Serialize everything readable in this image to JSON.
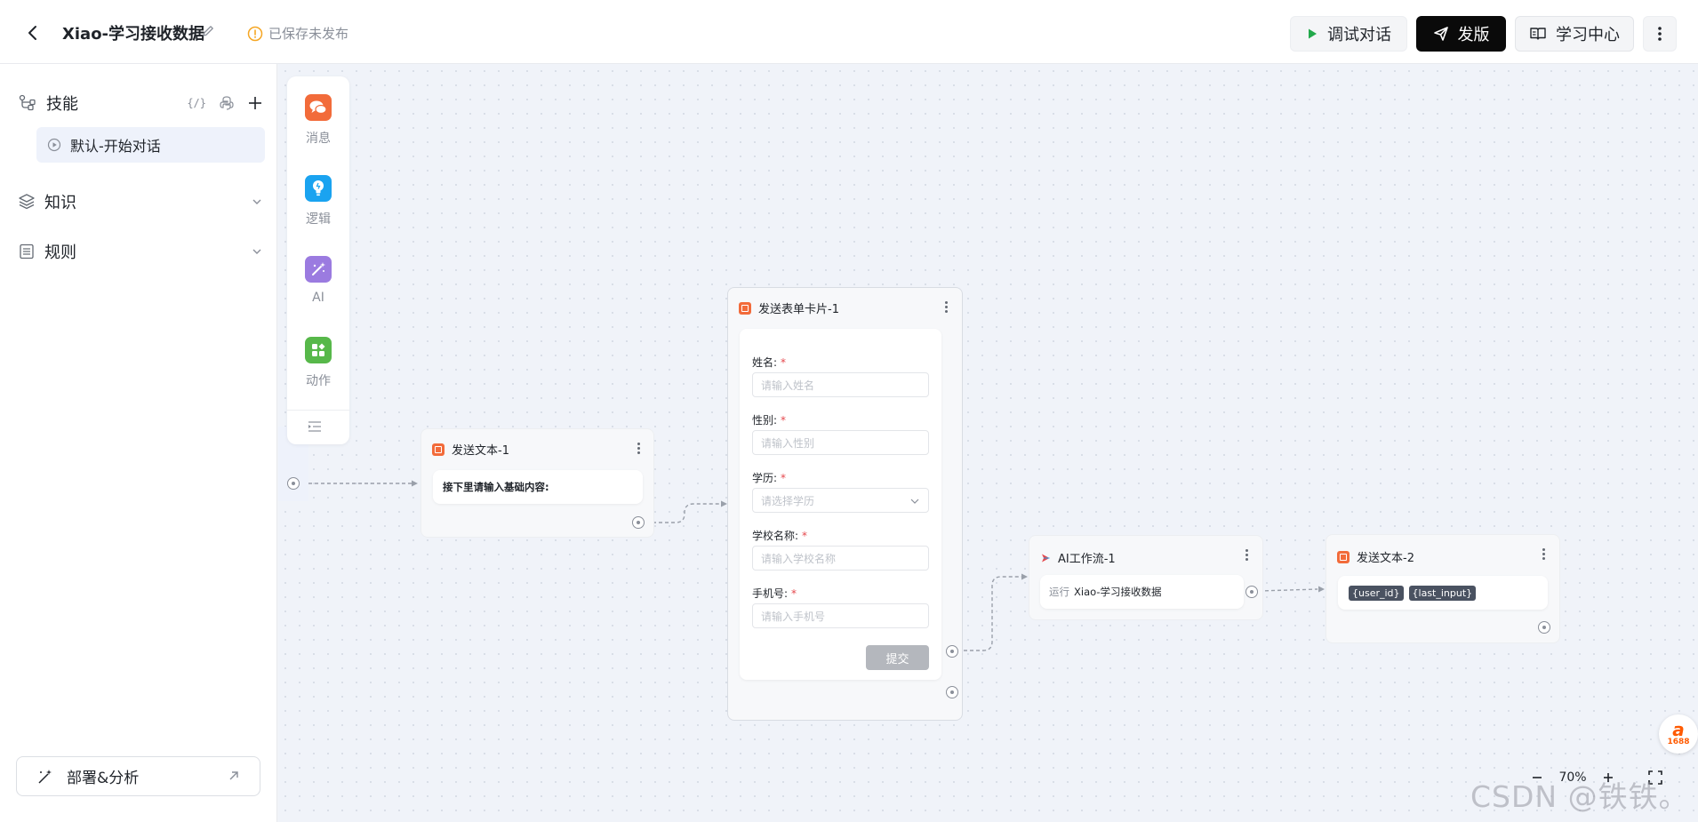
{
  "header": {
    "title": "Xiao-学习接收数据",
    "status": "已保存未发布",
    "debug_label": "调试对话",
    "publish_label": "发版",
    "learn_label": "学习中心"
  },
  "sidebar": {
    "skills_label": "技能",
    "skill_items": [
      {
        "label": "默认-开始对话"
      }
    ],
    "knowledge_label": "知识",
    "rules_label": "规则",
    "deploy_label": "部署&分析"
  },
  "palette": {
    "items": [
      {
        "label": "消息",
        "icon": "message-icon",
        "color": "#f26b3a"
      },
      {
        "label": "逻辑",
        "icon": "logic-icon",
        "color": "#1aa3f0"
      },
      {
        "label": "AI",
        "icon": "magic-wand-icon",
        "color": "#9b7be0"
      },
      {
        "label": "动作",
        "icon": "action-icon",
        "color": "#57b84a"
      }
    ]
  },
  "nodes": {
    "send_text_1": {
      "title": "发送文本-1",
      "content": "接下里请输入基础内容:"
    },
    "form_card_1": {
      "title": "发送表单卡片-1",
      "fields": [
        {
          "label": "姓名:",
          "placeholder": "请输入姓名",
          "type": "text"
        },
        {
          "label": "性别:",
          "placeholder": "请输入性别",
          "type": "text"
        },
        {
          "label": "学历:",
          "placeholder": "请选择学历",
          "type": "select"
        },
        {
          "label": "学校名称:",
          "placeholder": "请输入学校名称",
          "type": "text"
        },
        {
          "label": "手机号:",
          "placeholder": "请输入手机号",
          "type": "text"
        }
      ],
      "submit_label": "提交"
    },
    "ai_workflow_1": {
      "title": "AI工作流-1",
      "run_prefix": "运行",
      "run_target": "Xiao-学习接收数据"
    },
    "send_text_2": {
      "title": "发送文本-2",
      "vars": [
        "{user_id}",
        "{last_input}"
      ]
    }
  },
  "zoom": {
    "value": "70%"
  },
  "watermark": "CSDN @铁铁。",
  "badge": {
    "brand": "1688"
  }
}
